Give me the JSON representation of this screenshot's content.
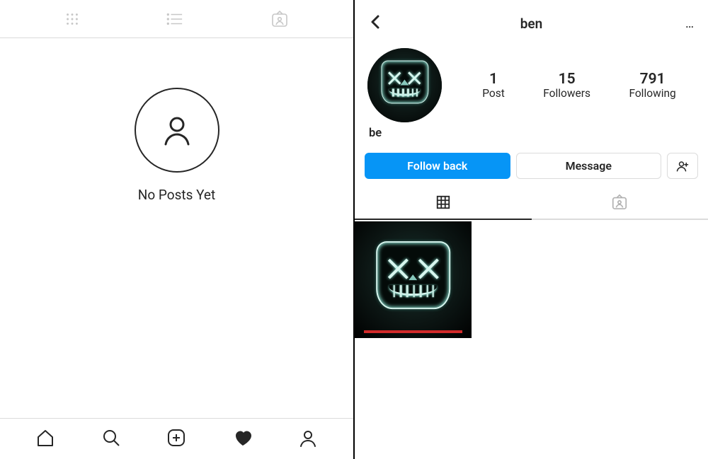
{
  "left": {
    "tabs": [
      "grid-icon",
      "list-icon",
      "tagged-icon"
    ],
    "empty_state_text": "No Posts Yet",
    "bottom_nav": [
      "home-icon",
      "search-icon",
      "new-post-icon",
      "activity-heart-icon",
      "profile-icon"
    ]
  },
  "right": {
    "header": {
      "username": "ben",
      "more_label": "…"
    },
    "stats": {
      "posts": {
        "count": "1",
        "label": "Post"
      },
      "followers": {
        "count": "15",
        "label": "Followers"
      },
      "following": {
        "count": "791",
        "label": "Following"
      }
    },
    "display_name": "be",
    "actions": {
      "follow_back_label": "Follow back",
      "message_label": "Message",
      "suggested_label": "suggested-people-icon"
    },
    "profile_tabs": {
      "grid": "grid-icon",
      "tagged": "tagged-icon",
      "active": "grid"
    },
    "posts": [
      {
        "name": "post-1-mask-photo"
      }
    ]
  },
  "colors": {
    "primary_blue": "#0695f6",
    "text": "#262626",
    "muted": "#8e8e8e",
    "border": "#dbdbdb"
  }
}
